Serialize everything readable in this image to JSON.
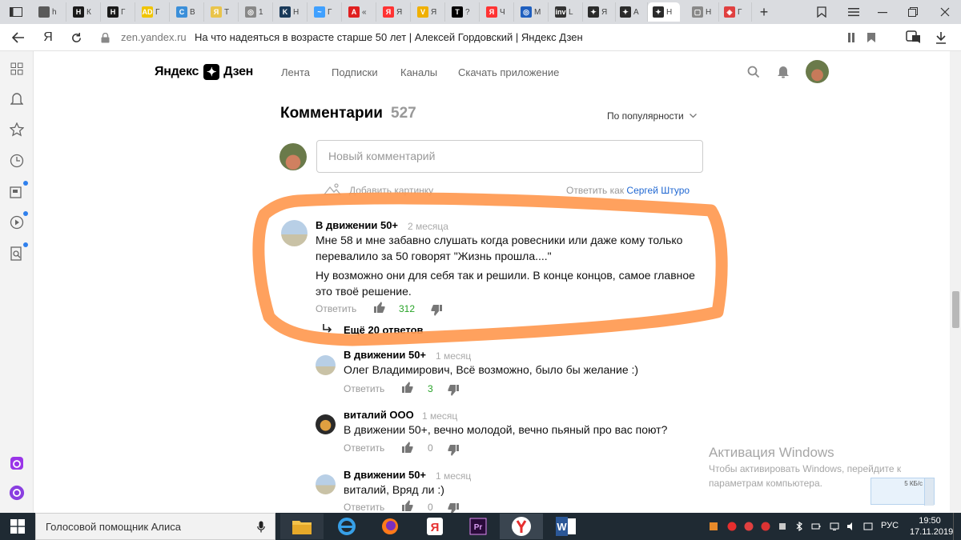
{
  "browser": {
    "tabs": [
      {
        "letter": "h",
        "color": "#5a5a5a",
        "fav": ""
      },
      {
        "letter": "К",
        "color": "#1a1a1a",
        "fav": "Н"
      },
      {
        "letter": "Г",
        "color": "#1a1a1a",
        "fav": "Н"
      },
      {
        "letter": "Г",
        "color": "#f0c400",
        "fav": "AD"
      },
      {
        "letter": "В",
        "color": "#3b8fd9",
        "fav": "C"
      },
      {
        "letter": "Т",
        "color": "#e9c44b",
        "fav": "Я"
      },
      {
        "letter": "1",
        "color": "#888888",
        "fav": "◎"
      },
      {
        "letter": "Н",
        "color": "#1a3a5a",
        "fav": "K"
      },
      {
        "letter": "Г",
        "color": "#3fa0ff",
        "fav": "~"
      },
      {
        "letter": "«",
        "color": "#e02020",
        "fav": "A"
      },
      {
        "letter": "Я",
        "color": "#ff3333",
        "fav": "Я"
      },
      {
        "letter": "Я",
        "color": "#f0b000",
        "fav": "V"
      },
      {
        "letter": "?",
        "color": "#000000",
        "fav": "T"
      },
      {
        "letter": "Ч",
        "color": "#ff3333",
        "fav": "Я"
      },
      {
        "letter": "М",
        "color": "#1f5fbf",
        "fav": "◎"
      },
      {
        "letter": "L",
        "color": "#333333",
        "fav": "inv"
      },
      {
        "letter": "Я",
        "color": "#2b2b2b",
        "fav": "✦"
      },
      {
        "letter": "А",
        "color": "#2b2b2b",
        "fav": "✦"
      },
      {
        "letter": "Н",
        "color": "#2b2b2b",
        "fav": "✦"
      },
      {
        "letter": "Н",
        "color": "#888888",
        "fav": "▢"
      },
      {
        "letter": "Г",
        "color": "#e04040",
        "fav": "◈"
      }
    ],
    "new_tab": "+",
    "url_domain": "zen.yandex.ru",
    "url_title": "На что надеяться в возрасте старше 50 лет | Алексей Гордовский | Яндекс Дзен",
    "yandex_letter": "Я"
  },
  "zen": {
    "logo_left": "Яндекс",
    "logo_right": "Дзен",
    "nav": [
      "Лента",
      "Подписки",
      "Каналы",
      "Скачать приложение"
    ]
  },
  "comments": {
    "title": "Комментарии",
    "count": "527",
    "sort": "По популярности",
    "new_placeholder": "Новый комментарий",
    "add_picture": "Добавить картинку",
    "reply_as": "Ответить как",
    "reply_as_user": "Сергей Штуро",
    "reply_label": "Ответить",
    "more_replies": "Ещё 20 ответов",
    "items": [
      {
        "author": "В движении 50+",
        "ago": "2 месяца",
        "lines": [
          "Мне 58 и мне забавно слушать когда ровесники или даже кому только",
          "перевалило за 50 говорят \"Жизнь прошла....\""
        ],
        "lines2": [
          "Ну возможно они для себя так и решили. В конце концов, самое главное",
          "это твоё решение."
        ],
        "likes": "312"
      },
      {
        "author": "В движении 50+",
        "ago": "1 месяц",
        "text": "Олег Владимирович, Всё возможно, было бы желание :)",
        "likes": "3"
      },
      {
        "author": "виталий ООО",
        "ago": "1 месяц",
        "text": "В движении 50+, вечно молодой, вечно пьяный про вас поют?",
        "likes": "0"
      },
      {
        "author": "В движении 50+",
        "ago": "1 месяц",
        "text": "виталий, Вряд ли :)",
        "likes": "0"
      }
    ]
  },
  "watermark": {
    "title": "Активация Windows",
    "line1": "Чтобы активировать Windows, перейдите к",
    "line2": "параметрам компьютера."
  },
  "speed": "5 КБ/с",
  "taskbar": {
    "search": "Голосовой помощник Алиса",
    "lang": "РУС",
    "time": "19:50",
    "date": "17.11.2019"
  },
  "colors": {
    "highlight": "#ff9950",
    "accent": "#1f67d2",
    "like_green": "#27a327"
  }
}
